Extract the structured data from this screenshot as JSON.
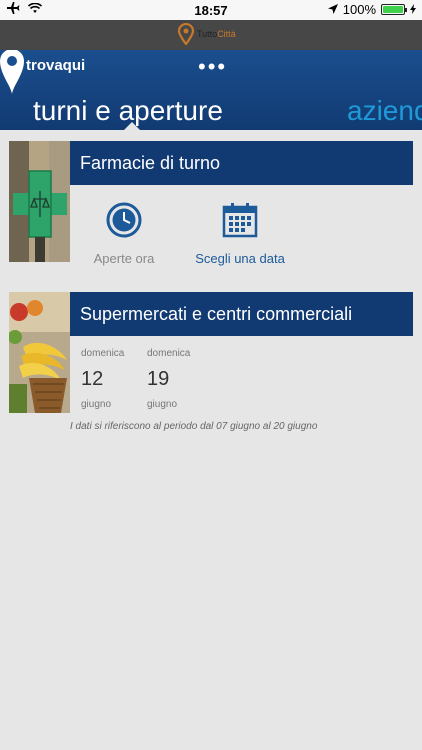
{
  "status_bar": {
    "time": "18:57",
    "battery_percent": "100%",
    "battery_level": 1.0
  },
  "brand": {
    "name_dark": "Tutto",
    "name_accent": "Città"
  },
  "nav": {
    "logo_text": "trovaqui",
    "menu": "•••",
    "active_tab": "turni e aperture",
    "next_tab": "aziende"
  },
  "pharmacies": {
    "title": "Farmacie di turno",
    "open_now_label": "Aperte ora",
    "choose_date_label": "Scegli una data"
  },
  "supermarkets": {
    "title": "Supermercati e centri commerciali",
    "days": [
      {
        "day": "domenica",
        "date": "12",
        "month": "giugno"
      },
      {
        "day": "domenica",
        "date": "19",
        "month": "giugno"
      }
    ],
    "note": "I dati si riferiscono al periodo dal 07 giugno al 20 giugno"
  },
  "colors": {
    "primary": "#113a72",
    "accent": "#1e9ad8",
    "link": "#1d5a9a",
    "muted": "#888888"
  }
}
